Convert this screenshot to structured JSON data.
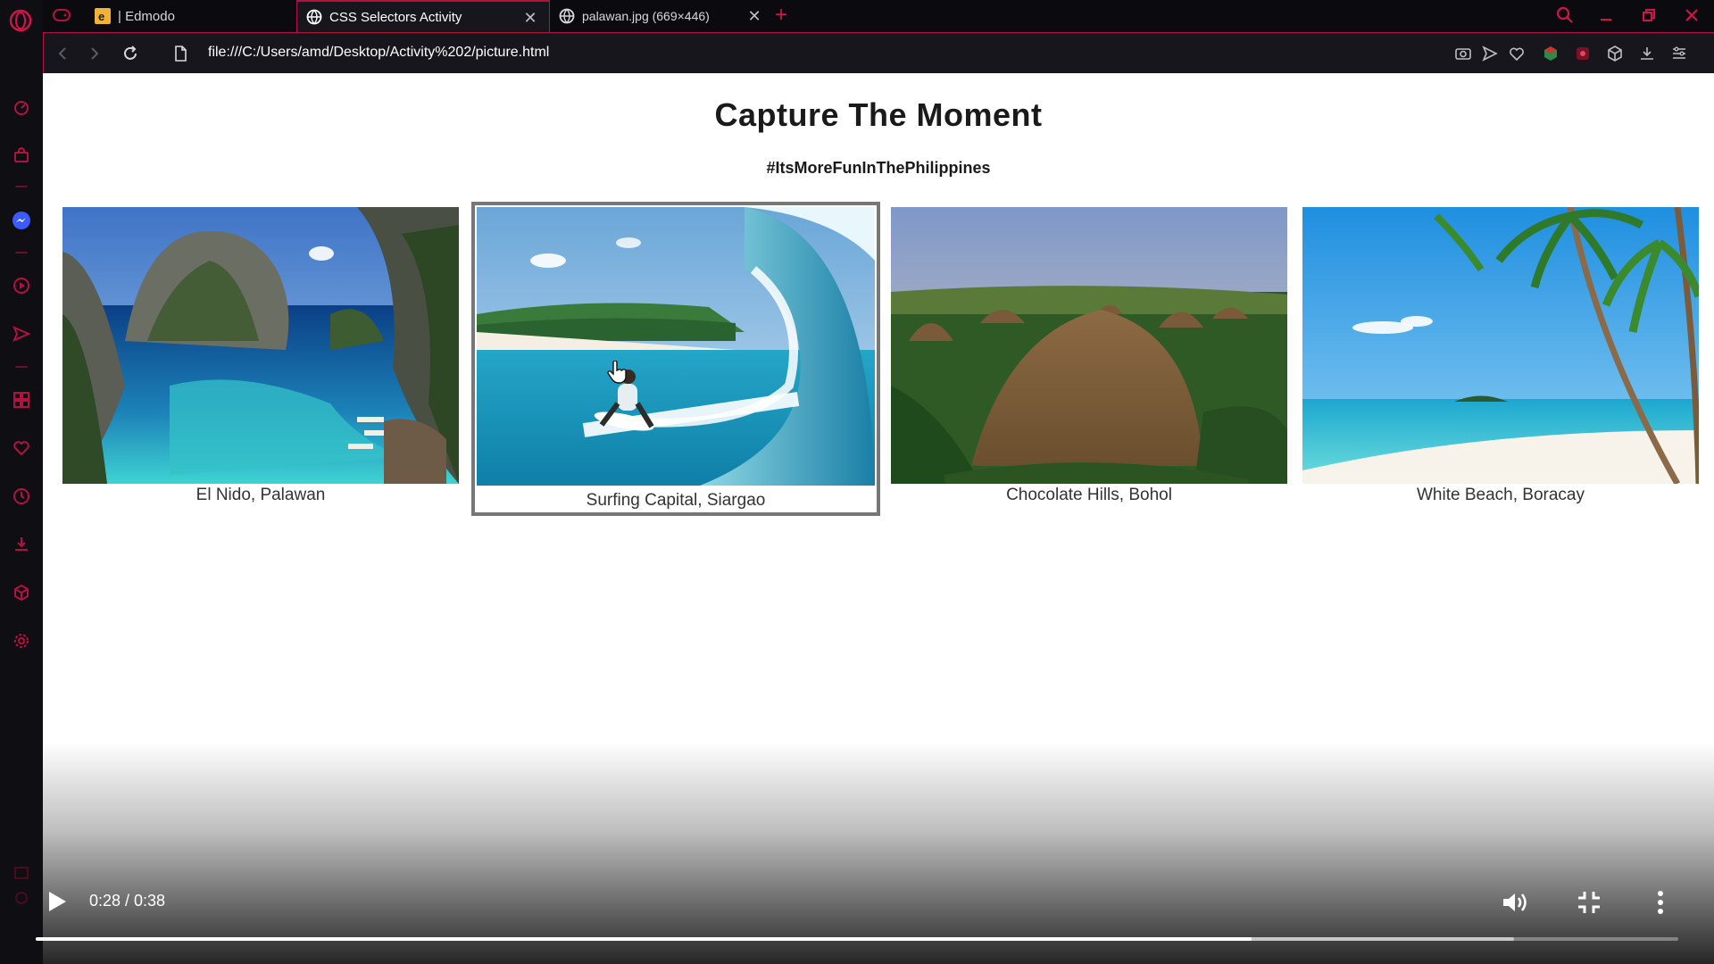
{
  "tabs": [
    {
      "label": "| Edmodo",
      "favicon": "edmodo-icon",
      "active": false
    },
    {
      "label": "CSS Selectors Activity",
      "favicon": "globe-icon",
      "active": true
    },
    {
      "label": "palawan.jpg (669×446)",
      "favicon": "globe-icon",
      "active": false
    }
  ],
  "address": {
    "url": "file:///C:/Users/amd/Desktop/Activity%202/picture.html"
  },
  "page": {
    "title": "Capture The Moment",
    "subtitle": "#ItsMoreFunInThePhilippines",
    "gallery": [
      {
        "caption": "El Nido, Palawan",
        "image": "lagoon-cliffs-photo",
        "selected": false
      },
      {
        "caption": "Surfing Capital, Siargao",
        "image": "surfer-wave-photo",
        "selected": true
      },
      {
        "caption": "Chocolate Hills, Bohol",
        "image": "brown-hills-photo",
        "selected": false
      },
      {
        "caption": "White Beach, Boracay",
        "image": "palm-beach-photo",
        "selected": false
      }
    ]
  },
  "video": {
    "time": "0:28 / 0:38",
    "progress_fraction": 0.74,
    "buffered_fraction": 0.9
  },
  "colors": {
    "accent": "#d4124a",
    "sidebar_bg": "#0e0e13",
    "toolbar_bg": "#16161c"
  }
}
